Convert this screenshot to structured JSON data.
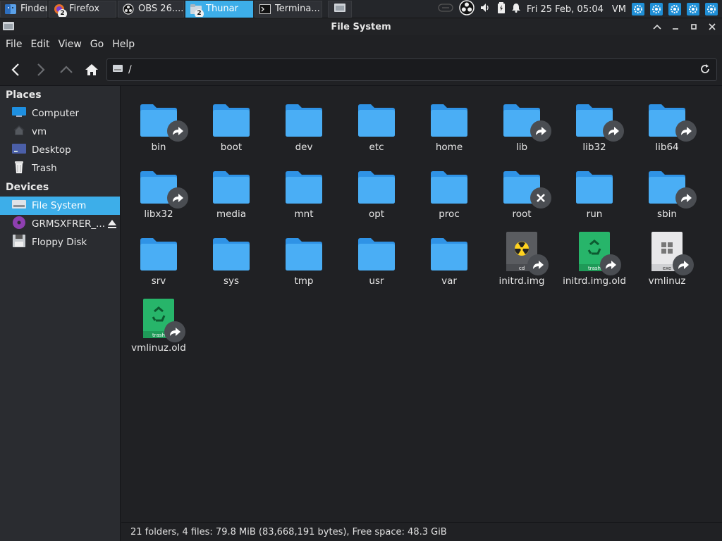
{
  "taskbar": {
    "tasks": [
      {
        "label": "Finder",
        "icon": "finder-icon",
        "badge": ""
      },
      {
        "label": "Firefox",
        "icon": "firefox-icon",
        "badge": "2"
      },
      {
        "label": "OBS 26....",
        "icon": "obs-icon",
        "badge": ""
      },
      {
        "label": "Thunar",
        "icon": "folder-icon",
        "badge": "2",
        "active": true
      },
      {
        "label": "Termina...",
        "icon": "terminal-icon",
        "badge": ""
      }
    ],
    "clock": "Fri 25 Feb, 05:04",
    "user": "VM"
  },
  "window": {
    "title": "File System"
  },
  "menu": [
    "File",
    "Edit",
    "View",
    "Go",
    "Help"
  ],
  "location": {
    "path": "/"
  },
  "sidebar": {
    "places_title": "Places",
    "places": [
      {
        "label": "Computer",
        "icon": "monitor-icon"
      },
      {
        "label": "vm",
        "icon": "home-icon"
      },
      {
        "label": "Desktop",
        "icon": "desktop-icon"
      },
      {
        "label": "Trash",
        "icon": "trash-icon"
      }
    ],
    "devices_title": "Devices",
    "devices": [
      {
        "label": "File System",
        "icon": "drive-icon",
        "selected": true
      },
      {
        "label": "GRMSXFRER_...",
        "icon": "disc-icon",
        "eject": true
      },
      {
        "label": "Floppy Disk",
        "icon": "floppy-icon"
      }
    ]
  },
  "files": [
    {
      "name": "bin",
      "type": "folder",
      "emblem": "link"
    },
    {
      "name": "boot",
      "type": "folder"
    },
    {
      "name": "dev",
      "type": "folder"
    },
    {
      "name": "etc",
      "type": "folder"
    },
    {
      "name": "home",
      "type": "folder"
    },
    {
      "name": "lib",
      "type": "folder",
      "emblem": "link"
    },
    {
      "name": "lib32",
      "type": "folder",
      "emblem": "link"
    },
    {
      "name": "lib64",
      "type": "folder",
      "emblem": "link"
    },
    {
      "name": "libx32",
      "type": "folder",
      "emblem": "link"
    },
    {
      "name": "media",
      "type": "folder"
    },
    {
      "name": "mnt",
      "type": "folder"
    },
    {
      "name": "opt",
      "type": "folder"
    },
    {
      "name": "proc",
      "type": "folder"
    },
    {
      "name": "root",
      "type": "folder",
      "emblem": "unreadable"
    },
    {
      "name": "run",
      "type": "folder"
    },
    {
      "name": "sbin",
      "type": "folder",
      "emblem": "link"
    },
    {
      "name": "srv",
      "type": "folder"
    },
    {
      "name": "sys",
      "type": "folder"
    },
    {
      "name": "tmp",
      "type": "folder"
    },
    {
      "name": "usr",
      "type": "folder"
    },
    {
      "name": "var",
      "type": "folder"
    },
    {
      "name": "initrd.img",
      "type": "cd",
      "tag": "cd",
      "emblem": "link"
    },
    {
      "name": "initrd.img.old",
      "type": "trashfile",
      "tag": "trash",
      "emblem": "link"
    },
    {
      "name": "vmlinuz",
      "type": "exe",
      "tag": "exe",
      "emblem": "link"
    },
    {
      "name": "vmlinuz.old",
      "type": "trashfile",
      "tag": "trash",
      "emblem": "link"
    }
  ],
  "status": "21 folders, 4 files: 79.8 MiB (83,668,191 bytes), Free space: 48.3 GiB",
  "colors": {
    "accent": "#3daee9",
    "folder": "#3ba6f0"
  }
}
